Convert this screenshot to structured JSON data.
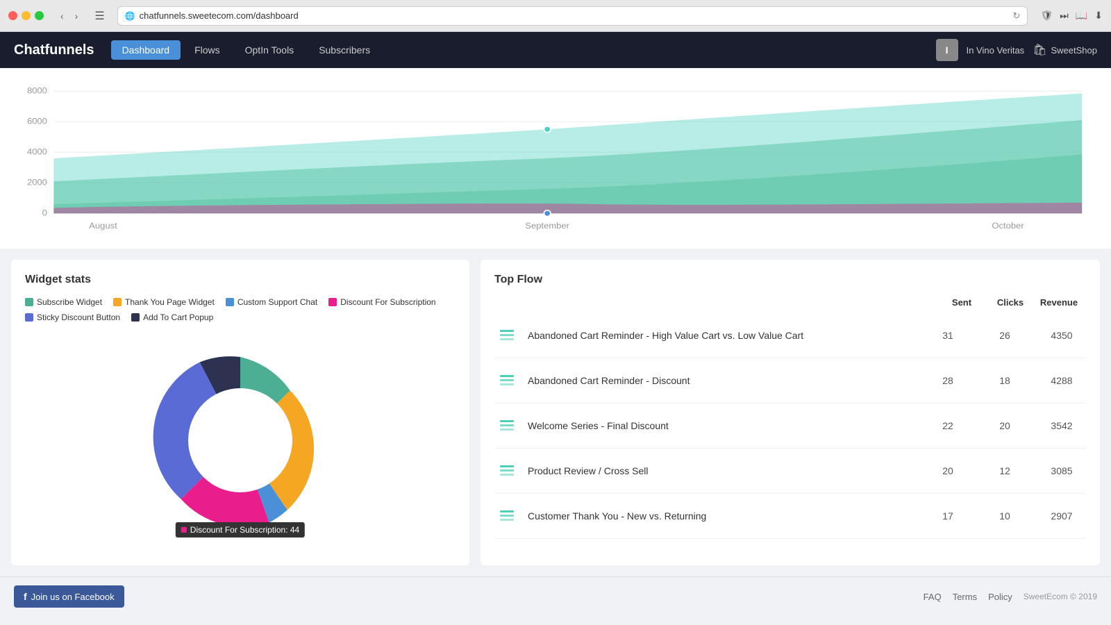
{
  "browser": {
    "url": "chatfunnels.sweetecom.com/dashboard",
    "reload_label": "↻"
  },
  "navbar": {
    "logo": "Chatfunnels",
    "links": [
      {
        "label": "Dashboard",
        "active": true
      },
      {
        "label": "Flows",
        "active": false
      },
      {
        "label": "OptIn Tools",
        "active": false
      },
      {
        "label": "Subscribers",
        "active": false
      }
    ],
    "user_initial": "I",
    "user_name": "In Vino Veritas",
    "store_name": "SweetShop"
  },
  "chart": {
    "y_labels": [
      "8000",
      "6000",
      "4000",
      "2000",
      "0"
    ],
    "x_labels": [
      "August",
      "September",
      "October"
    ]
  },
  "widget_stats": {
    "title": "Widget stats",
    "legend": [
      {
        "label": "Subscribe Widget",
        "color": "#4caf93"
      },
      {
        "label": "Thank You Page Widget",
        "color": "#f5a623"
      },
      {
        "label": "Custom Support Chat",
        "color": "#4a90d9"
      },
      {
        "label": "Discount For Subscription",
        "color": "#e91e8c"
      },
      {
        "label": "Sticky Discount Button",
        "color": "#5b6bd6"
      },
      {
        "label": "Add To Cart Popup",
        "color": "#2d3250"
      }
    ],
    "donut": {
      "segments": [
        {
          "label": "Subscribe Widget",
          "color": "#4caf93",
          "value": 10,
          "percent": 10
        },
        {
          "label": "Thank You Page Widget",
          "color": "#f5a623",
          "value": 28,
          "percent": 28
        },
        {
          "label": "Custom Support Chat",
          "color": "#4a90d9",
          "value": 5,
          "percent": 5
        },
        {
          "label": "Discount For Subscription",
          "color": "#e91e8c",
          "value": 20,
          "percent": 20
        },
        {
          "label": "Sticky Discount Button",
          "color": "#5b6bd6",
          "value": 22,
          "percent": 22
        },
        {
          "label": "Add To Cart Popup",
          "color": "#2d3250",
          "value": 15,
          "percent": 15
        }
      ],
      "tooltip_label": "Discount For Subscription: 44"
    }
  },
  "top_flow": {
    "title": "Top Flow",
    "columns": [
      "Sent",
      "Clicks",
      "Revenue"
    ],
    "rows": [
      {
        "name": "Abandoned Cart Reminder - High Value Cart vs. Low Value Cart",
        "sent": 31,
        "clicks": 26,
        "revenue": 4350
      },
      {
        "name": "Abandoned Cart Reminder - Discount",
        "sent": 28,
        "clicks": 18,
        "revenue": 4288
      },
      {
        "name": "Welcome Series - Final Discount",
        "sent": 22,
        "clicks": 20,
        "revenue": 3542
      },
      {
        "name": "Product Review / Cross Sell",
        "sent": 20,
        "clicks": 12,
        "revenue": 3085
      },
      {
        "name": "Customer Thank You - New vs. Returning",
        "sent": 17,
        "clicks": 10,
        "revenue": 2907
      }
    ]
  },
  "footer": {
    "facebook_btn": "Join us on Facebook",
    "links": [
      "FAQ",
      "Terms",
      "Policy"
    ],
    "copyright": "SweetEcom © 2019"
  }
}
